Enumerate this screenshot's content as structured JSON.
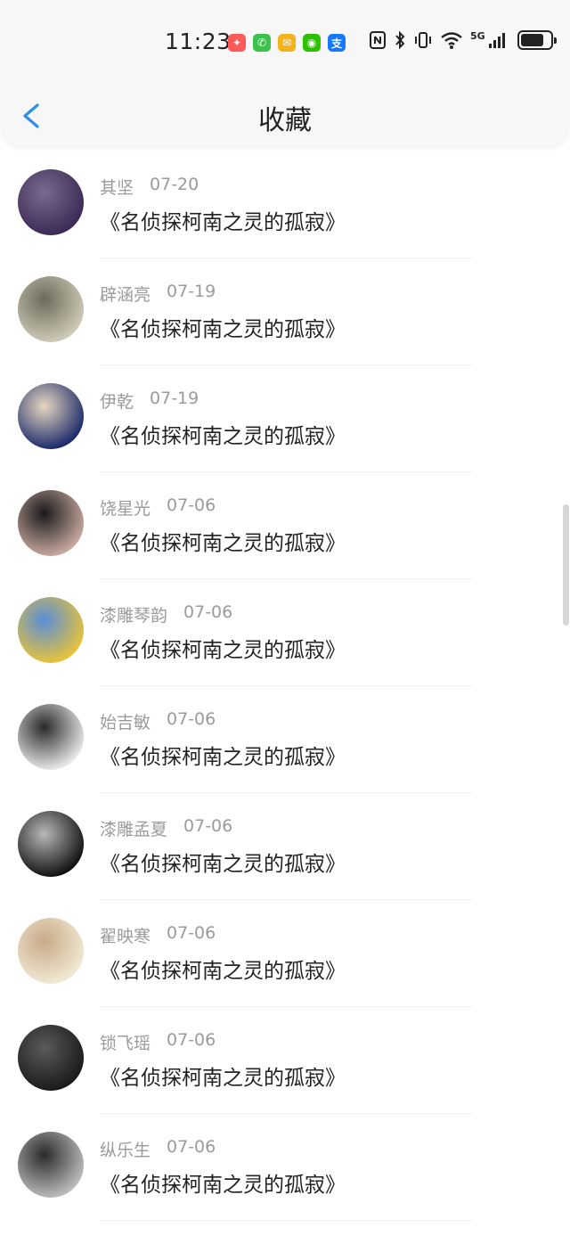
{
  "status_bar": {
    "time": "11:23",
    "network_label": "5G",
    "battery_percent": 80,
    "app_icons": [
      {
        "name": "multicolor-app-icon",
        "glyph": "✦",
        "color": "#ff5a5a"
      },
      {
        "name": "phone-app-icon",
        "glyph": "✆",
        "color": "#3cc24c"
      },
      {
        "name": "mail-app-icon",
        "glyph": "✉",
        "color": "#f5b31b"
      },
      {
        "name": "wechat-app-icon",
        "glyph": "◉",
        "color": "#2dc100"
      },
      {
        "name": "alipay-app-icon",
        "glyph": "支",
        "color": "#1677ff"
      }
    ]
  },
  "header": {
    "title": "收藏",
    "back_icon": "chevron-left-icon",
    "accent_color": "#2f8fe8"
  },
  "favorites": [
    {
      "user": "其坚",
      "date": "07-20",
      "title": "《名侦探柯南之灵的孤寂》",
      "avatar_colors": [
        "#3a2a55",
        "#7a6a8e"
      ]
    },
    {
      "user": "辟涵亮",
      "date": "07-19",
      "title": "《名侦探柯南之灵的孤寂》",
      "avatar_colors": [
        "#cfcbb8",
        "#6e6a5a"
      ]
    },
    {
      "user": "伊乾",
      "date": "07-19",
      "title": "《名侦探柯南之灵的孤寂》",
      "avatar_colors": [
        "#1a2a6a",
        "#e8d7c0"
      ]
    },
    {
      "user": "饶星光",
      "date": "07-06",
      "title": "《名侦探柯南之灵的孤寂》",
      "avatar_colors": [
        "#c9a9a0",
        "#1a1a1a"
      ]
    },
    {
      "user": "漆雕琴韵",
      "date": "07-06",
      "title": "《名侦探柯南之灵的孤寂》",
      "avatar_colors": [
        "#e7c33a",
        "#5a8ed8"
      ]
    },
    {
      "user": "始吉敏",
      "date": "07-06",
      "title": "《名侦探柯南之灵的孤寂》",
      "avatar_colors": [
        "#e9e9e9",
        "#2a2a2a"
      ]
    },
    {
      "user": "漆雕孟夏",
      "date": "07-06",
      "title": "《名侦探柯南之灵的孤寂》",
      "avatar_colors": [
        "#111111",
        "#b8b8b8"
      ]
    },
    {
      "user": "翟映寒",
      "date": "07-06",
      "title": "《名侦探柯南之灵的孤寂》",
      "avatar_colors": [
        "#f0ead2",
        "#c9a98a"
      ]
    },
    {
      "user": "锁飞瑶",
      "date": "07-06",
      "title": "《名侦探柯南之灵的孤寂》",
      "avatar_colors": [
        "#1a1a1a",
        "#5a5a5a"
      ]
    },
    {
      "user": "纵乐生",
      "date": "07-06",
      "title": "《名侦探柯南之灵的孤寂》",
      "avatar_colors": [
        "#bdbdbd",
        "#2a2a2a"
      ]
    }
  ]
}
